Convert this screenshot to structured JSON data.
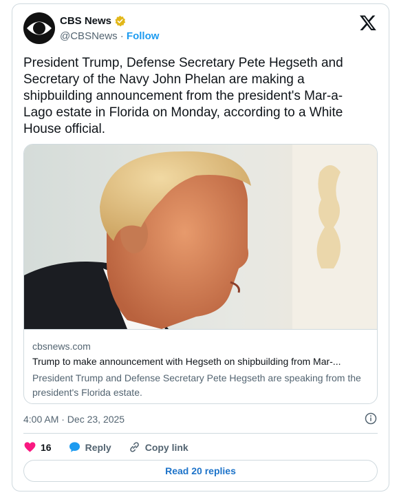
{
  "author": {
    "name": "CBS News",
    "handle": "@CBSNews",
    "follow_label": "Follow"
  },
  "tweet": {
    "text": "President Trump, Defense Secretary Pete Hegseth and Secretary of the Navy John Phelan are making a shipbuilding announcement from the president's Mar-a-Lago estate in Florida on Monday, according to a White House official.",
    "timestamp": "4:00 AM · Dec 23, 2025"
  },
  "link_card": {
    "domain": "cbsnews.com",
    "title": "Trump to make announcement with Hegseth on shipbuilding from Mar-...",
    "description": "President Trump and Defense Secretary Pete Hegseth are speaking from the president's Florida estate."
  },
  "actions": {
    "like_count": "16",
    "reply_label": "Reply",
    "copy_label": "Copy link"
  },
  "read_replies_label": "Read 20 replies",
  "icons": [
    "cbs-eye-icon",
    "verified-badge-icon",
    "x-logo-icon",
    "info-icon",
    "heart-icon",
    "reply-icon",
    "link-icon"
  ],
  "colors": {
    "accent": "#1d9bf0",
    "like": "#f91880",
    "verified": "#e2b719"
  }
}
